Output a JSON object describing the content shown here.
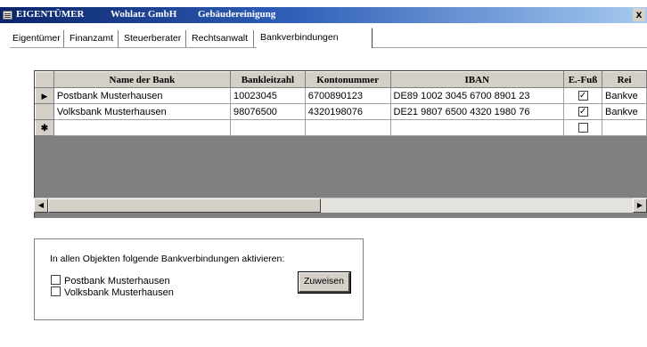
{
  "window": {
    "title_parts": [
      "EIGENTÜMER",
      "Wohlatz GmbH",
      "Gebäudereinigung"
    ],
    "close_glyph": "x"
  },
  "tabs": [
    {
      "label": "Eigentümer"
    },
    {
      "label": "Finanzamt"
    },
    {
      "label": "Steuerberater"
    },
    {
      "label": "Rechtsanwalt"
    },
    {
      "label": "Bankverbindungen"
    }
  ],
  "active_tab": "Bankverbindungen",
  "grid": {
    "columns": [
      "Name der Bank",
      "Bankleitzahl",
      "Kontonummer",
      "IBAN",
      "E.-Fuß",
      "Rei"
    ],
    "rows": [
      {
        "marker": "▶",
        "name": "Postbank Musterhausen",
        "blz": "10023045",
        "konto": "6700890123",
        "iban": "DE89 1002 3045 6700 8901 23",
        "efuss_checked": true,
        "reihe": "Bankve"
      },
      {
        "marker": "",
        "name": "Volksbank Musterhausen",
        "blz": "98076500",
        "konto": "4320198076",
        "iban": "DE21 9807 6500 4320 1980 76",
        "efuss_checked": true,
        "reihe": "Bankve"
      }
    ],
    "new_row_marker": "✱"
  },
  "assign": {
    "label": "In allen Objekten folgende Bankverbindungen aktivieren:",
    "options": [
      {
        "label": "Postbank Musterhausen",
        "checked": false
      },
      {
        "label": "Volksbank Musterhausen",
        "checked": false
      }
    ],
    "button_label": "Zuweisen"
  },
  "icons": {
    "app": "form-icon",
    "row_pointer": "record-pointer-icon",
    "new_row": "new-record-icon",
    "scroll_left": "scroll-left-icon",
    "scroll_right": "scroll-right-icon"
  }
}
